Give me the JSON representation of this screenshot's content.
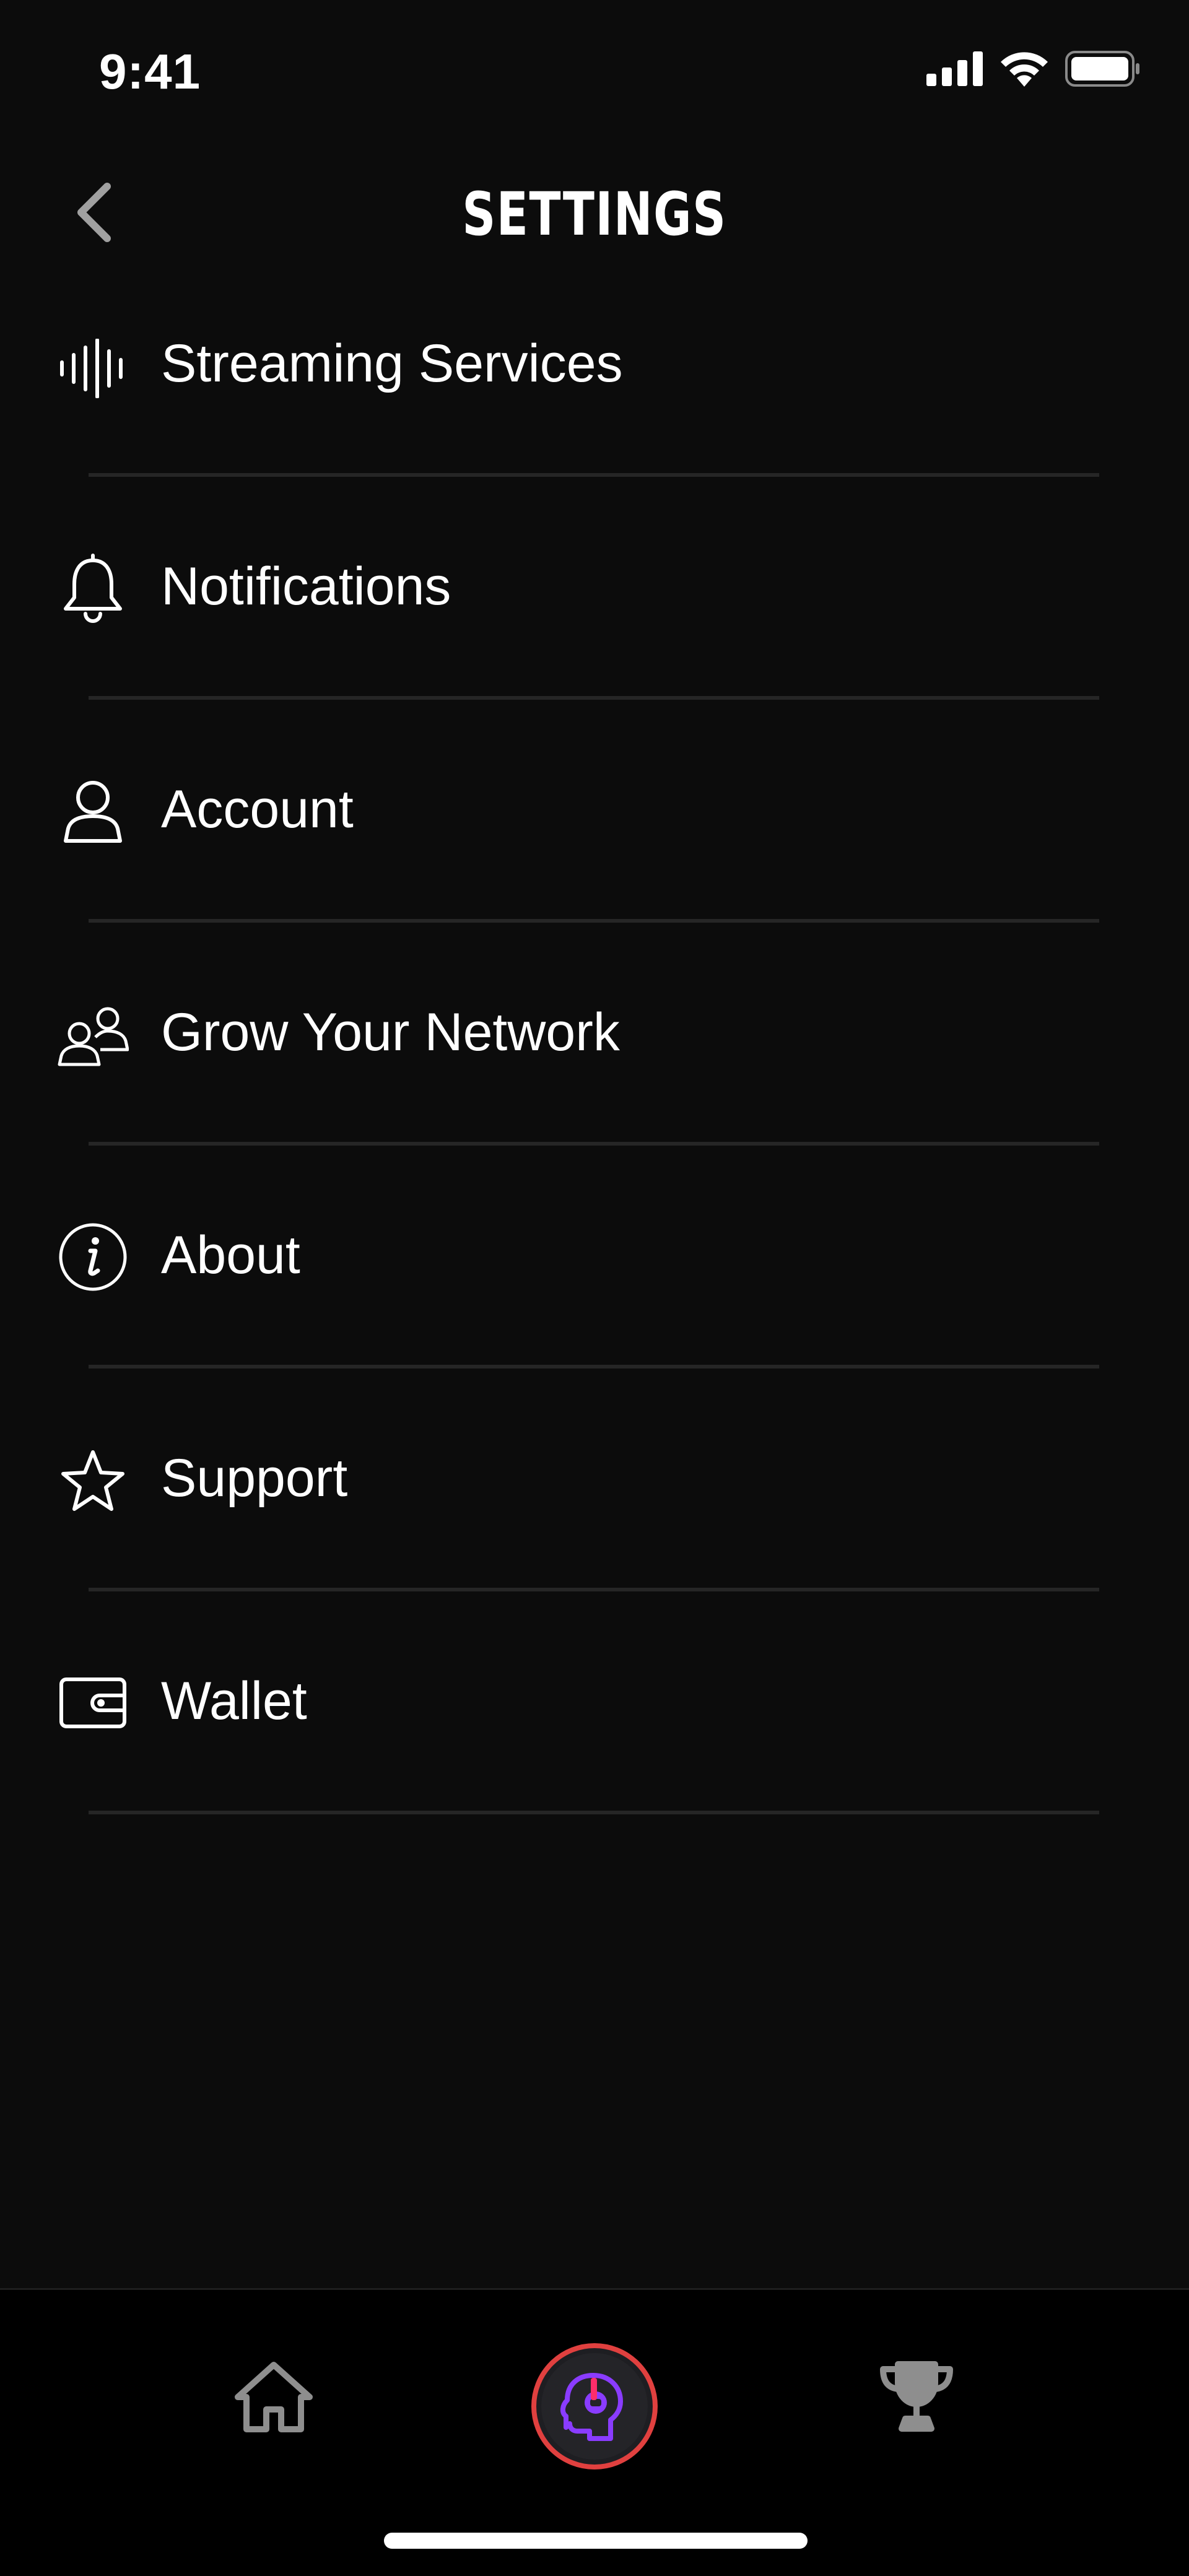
{
  "status_bar": {
    "time": "9:41",
    "icons": [
      "cellular-signal-icon",
      "wifi-icon",
      "battery-icon"
    ]
  },
  "header": {
    "title": "SETTINGS",
    "back_icon": "chevron-left-icon"
  },
  "settings": {
    "items": [
      {
        "label": "Streaming Services",
        "icon": "sound-wave-icon"
      },
      {
        "label": "Notifications",
        "icon": "bell-icon"
      },
      {
        "label": "Account",
        "icon": "person-icon"
      },
      {
        "label": "Grow Your Network",
        "icon": "people-icon"
      },
      {
        "label": "About",
        "icon": "info-icon"
      },
      {
        "label": "Support",
        "icon": "star-icon"
      },
      {
        "label": "Wallet",
        "icon": "wallet-icon"
      }
    ]
  },
  "tab_bar": {
    "tabs": [
      {
        "name": "home",
        "icon": "home-icon"
      },
      {
        "name": "profile",
        "icon": "headphone-head-icon",
        "active": true
      },
      {
        "name": "trophy",
        "icon": "trophy-icon"
      }
    ]
  },
  "colors": {
    "background": "#0c0c0c",
    "tab_bar_background": "#000000",
    "divider": "#262626",
    "text": "#ffffff",
    "inactive_icon": "#8e8e8e",
    "accent_ring": "#e0403f",
    "accent_purple": "#8a3cff",
    "accent_pink": "#ff2d6a"
  }
}
